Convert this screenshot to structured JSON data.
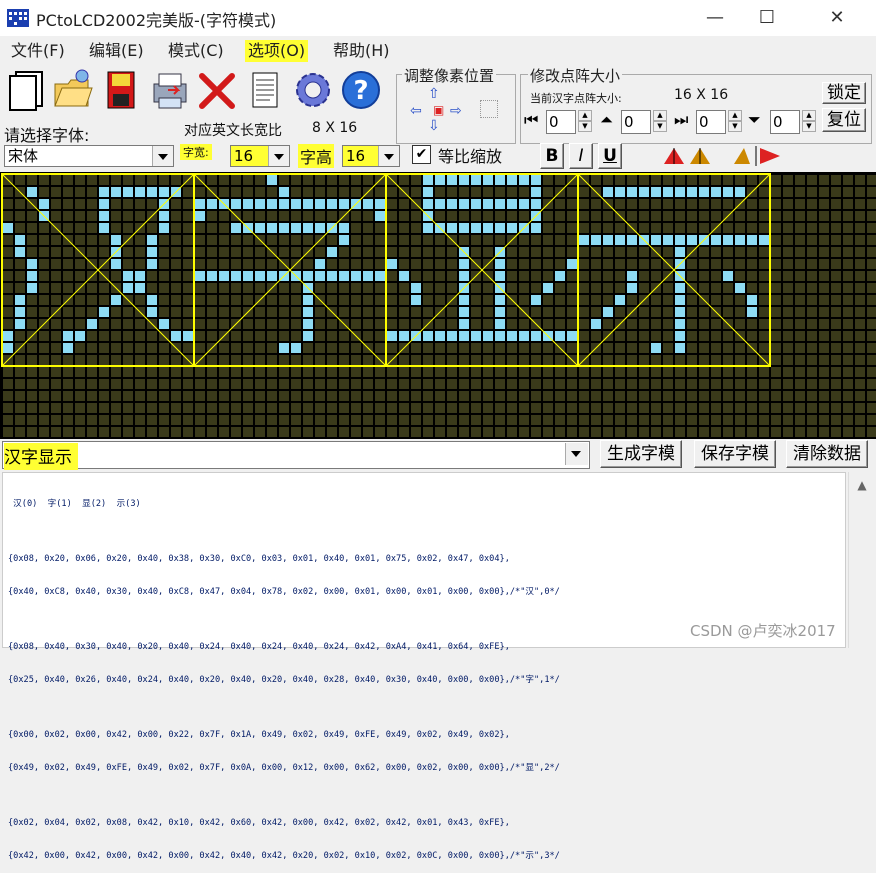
{
  "window": {
    "title": "PCtoLCD2002完美版-(字符模式)",
    "minimize": "—",
    "maximize": "☐",
    "close": "✕"
  },
  "menu": [
    {
      "label": "文件(F)",
      "highlighted": false
    },
    {
      "label": "编辑(E)",
      "highlighted": false
    },
    {
      "label": "模式(C)",
      "highlighted": false
    },
    {
      "label": "选项(O)",
      "highlighted": true
    },
    {
      "label": "帮助(H)",
      "highlighted": false
    }
  ],
  "toolbar": {
    "icons": [
      "new-file-icon",
      "open-folder-icon",
      "save-disk-icon",
      "print-icon",
      "delete-icon",
      "notepad-icon",
      "gear-icon",
      "help-icon"
    ]
  },
  "pixel_pos": {
    "title": "调整像素位置"
  },
  "matrix": {
    "title": "修改点阵大小",
    "current_label": "当前汉字点阵大小:",
    "current_value": "16  X  16",
    "lock_button": "锁定",
    "reset_button": "复位",
    "spinners": [
      "0",
      "0",
      "0",
      "0"
    ]
  },
  "font": {
    "select_label": "请选择字体:",
    "font_name": "宋体",
    "en_label": "对应英文长宽比",
    "en_value": "8  X  16",
    "width_label": "字宽:",
    "width_value": "16",
    "height_label": "字高",
    "height_value": "16",
    "scale_label": "等比缩放",
    "scale_checked": true,
    "bold": "B",
    "italic": "I",
    "underline": "U"
  },
  "colors": {
    "grid_bg": "#3a3a1a",
    "pixel_on": "#8edcf4",
    "frame": "#ffff00"
  },
  "input": {
    "value": "汉字显示"
  },
  "buttons": {
    "generate": "生成字模",
    "save": "保存字模",
    "clear": "清除数据"
  },
  "output_lines": [
    " 汉(0)  字(1)  显(2)  示(3)",
    "",
    "{0x08, 0x20, 0x06, 0x20, 0x40, 0x38, 0x30, 0xC0, 0x03, 0x01, 0x40, 0x01, 0x75, 0x02, 0x47, 0x04},",
    "{0x40, 0xC8, 0x40, 0x30, 0x40, 0xC8, 0x47, 0x04, 0x78, 0x02, 0x00, 0x01, 0x00, 0x01, 0x00, 0x00},/*\"汉\",0*/",
    "",
    "{0x08, 0x40, 0x30, 0x40, 0x20, 0x40, 0x24, 0x40, 0x24, 0x40, 0x24, 0x42, 0xA4, 0x41, 0x64, 0xFE},",
    "{0x25, 0x40, 0x26, 0x40, 0x24, 0x40, 0x20, 0x40, 0x20, 0x40, 0x28, 0x40, 0x30, 0x40, 0x00, 0x00},/*\"字\",1*/",
    "",
    "{0x00, 0x02, 0x00, 0x42, 0x00, 0x22, 0x7F, 0x1A, 0x49, 0x02, 0x49, 0xFE, 0x49, 0x02, 0x49, 0x02},",
    "{0x49, 0x02, 0x49, 0xFE, 0x49, 0x02, 0x7F, 0x0A, 0x00, 0x12, 0x00, 0x62, 0x00, 0x02, 0x00, 0x00},/*\"显\",2*/",
    "",
    "{0x02, 0x04, 0x02, 0x08, 0x42, 0x10, 0x42, 0x60, 0x42, 0x00, 0x42, 0x02, 0x42, 0x01, 0x43, 0xFE},",
    "{0x42, 0x00, 0x42, 0x00, 0x42, 0x00, 0x42, 0x40, 0x42, 0x20, 0x02, 0x10, 0x02, 0x0C, 0x00, 0x00},/*\"示\",3*/"
  ],
  "watermark": "CSDN @卢奕冰2017",
  "glyphs": [
    [
      "................",
      "..x.....xxxxxxx.",
      "...x....x....x..",
      "...x....x....x..",
      "x.......x....x..",
      ".x.......x..x...",
      ".x.......x..x...",
      "..x......x..x...",
      "..x.......xx....",
      "..x.......xx....",
      ".x.......x..x...",
      ".x......x...x...",
      ".x.....x.....x..",
      "x....xx.......xx",
      "x....x..........",
      "................"
    ],
    [
      "......x.........",
      ".......x........",
      "xxxxxxxxxxxxxxxx",
      "x..............x",
      "...xxxxxxxxxx...",
      "............x...",
      "...........x....",
      "..........x.....",
      "xxxxxxxxxxxxxxxx",
      ".........x......",
      ".........x......",
      ".........x......",
      ".........x......",
      ".........x......",
      ".......xx.......",
      "................"
    ],
    [
      "...xxxxxxxxxx...",
      "...x........x...",
      "...xxxxxxxxxx...",
      "...x........x...",
      "...xxxxxxxxxx...",
      "................",
      "......x..x......",
      "x.....x..x.....x",
      ".x....x..x....x.",
      "..x...x..x...x..",
      "..x...x..x..x...",
      "......x..x......",
      "......x..x......",
      "xxxxxxxxxxxxxxxx",
      "................",
      "................"
    ],
    [
      "................",
      "..xxxxxxxxxxxx..",
      "................",
      "................",
      "................",
      "xxxxxxxxxxxxxxxx",
      "........x.......",
      "........x.......",
      "....x...x...x...",
      "....x...x....x..",
      "...x....x.....x.",
      "..x.....x.....x.",
      ".x......x.......",
      "........x.......",
      "......x.x.......",
      "................"
    ]
  ]
}
